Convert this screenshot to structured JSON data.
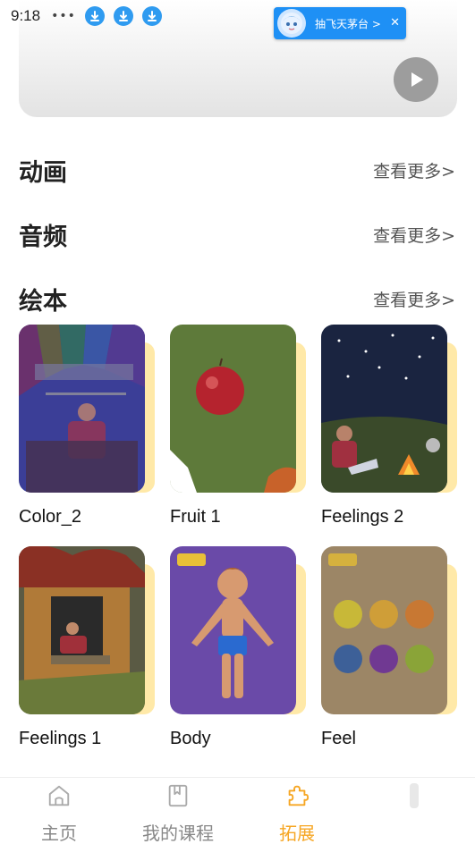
{
  "status_bar": {
    "time": "9:18",
    "dots": "•••",
    "notification": {
      "text": "抽飞天茅台 >",
      "close": "✕"
    }
  },
  "sections": [
    {
      "title": "动画",
      "more": "查看更多>"
    },
    {
      "title": "音频",
      "more": "查看更多>"
    },
    {
      "title": "绘本",
      "more": "查看更多>"
    }
  ],
  "books": [
    {
      "title": "Color_2"
    },
    {
      "title": "Fruit 1"
    },
    {
      "title": "Feelings 2"
    },
    {
      "title": "Feelings 1"
    },
    {
      "title": "Body"
    },
    {
      "title": "Feel"
    }
  ],
  "bottom_nav": {
    "items": [
      {
        "label": "主页",
        "icon": "home-icon"
      },
      {
        "label": "我的课程",
        "icon": "bookmark-book-icon"
      },
      {
        "label": "拓展",
        "icon": "puzzle-icon"
      }
    ],
    "active_color": "#f6a623",
    "inactive_color": "#888888"
  },
  "colors": {
    "accent": "#f6a623",
    "download_blue": "#2f9bf0",
    "book_page": "#ffe9a8"
  }
}
